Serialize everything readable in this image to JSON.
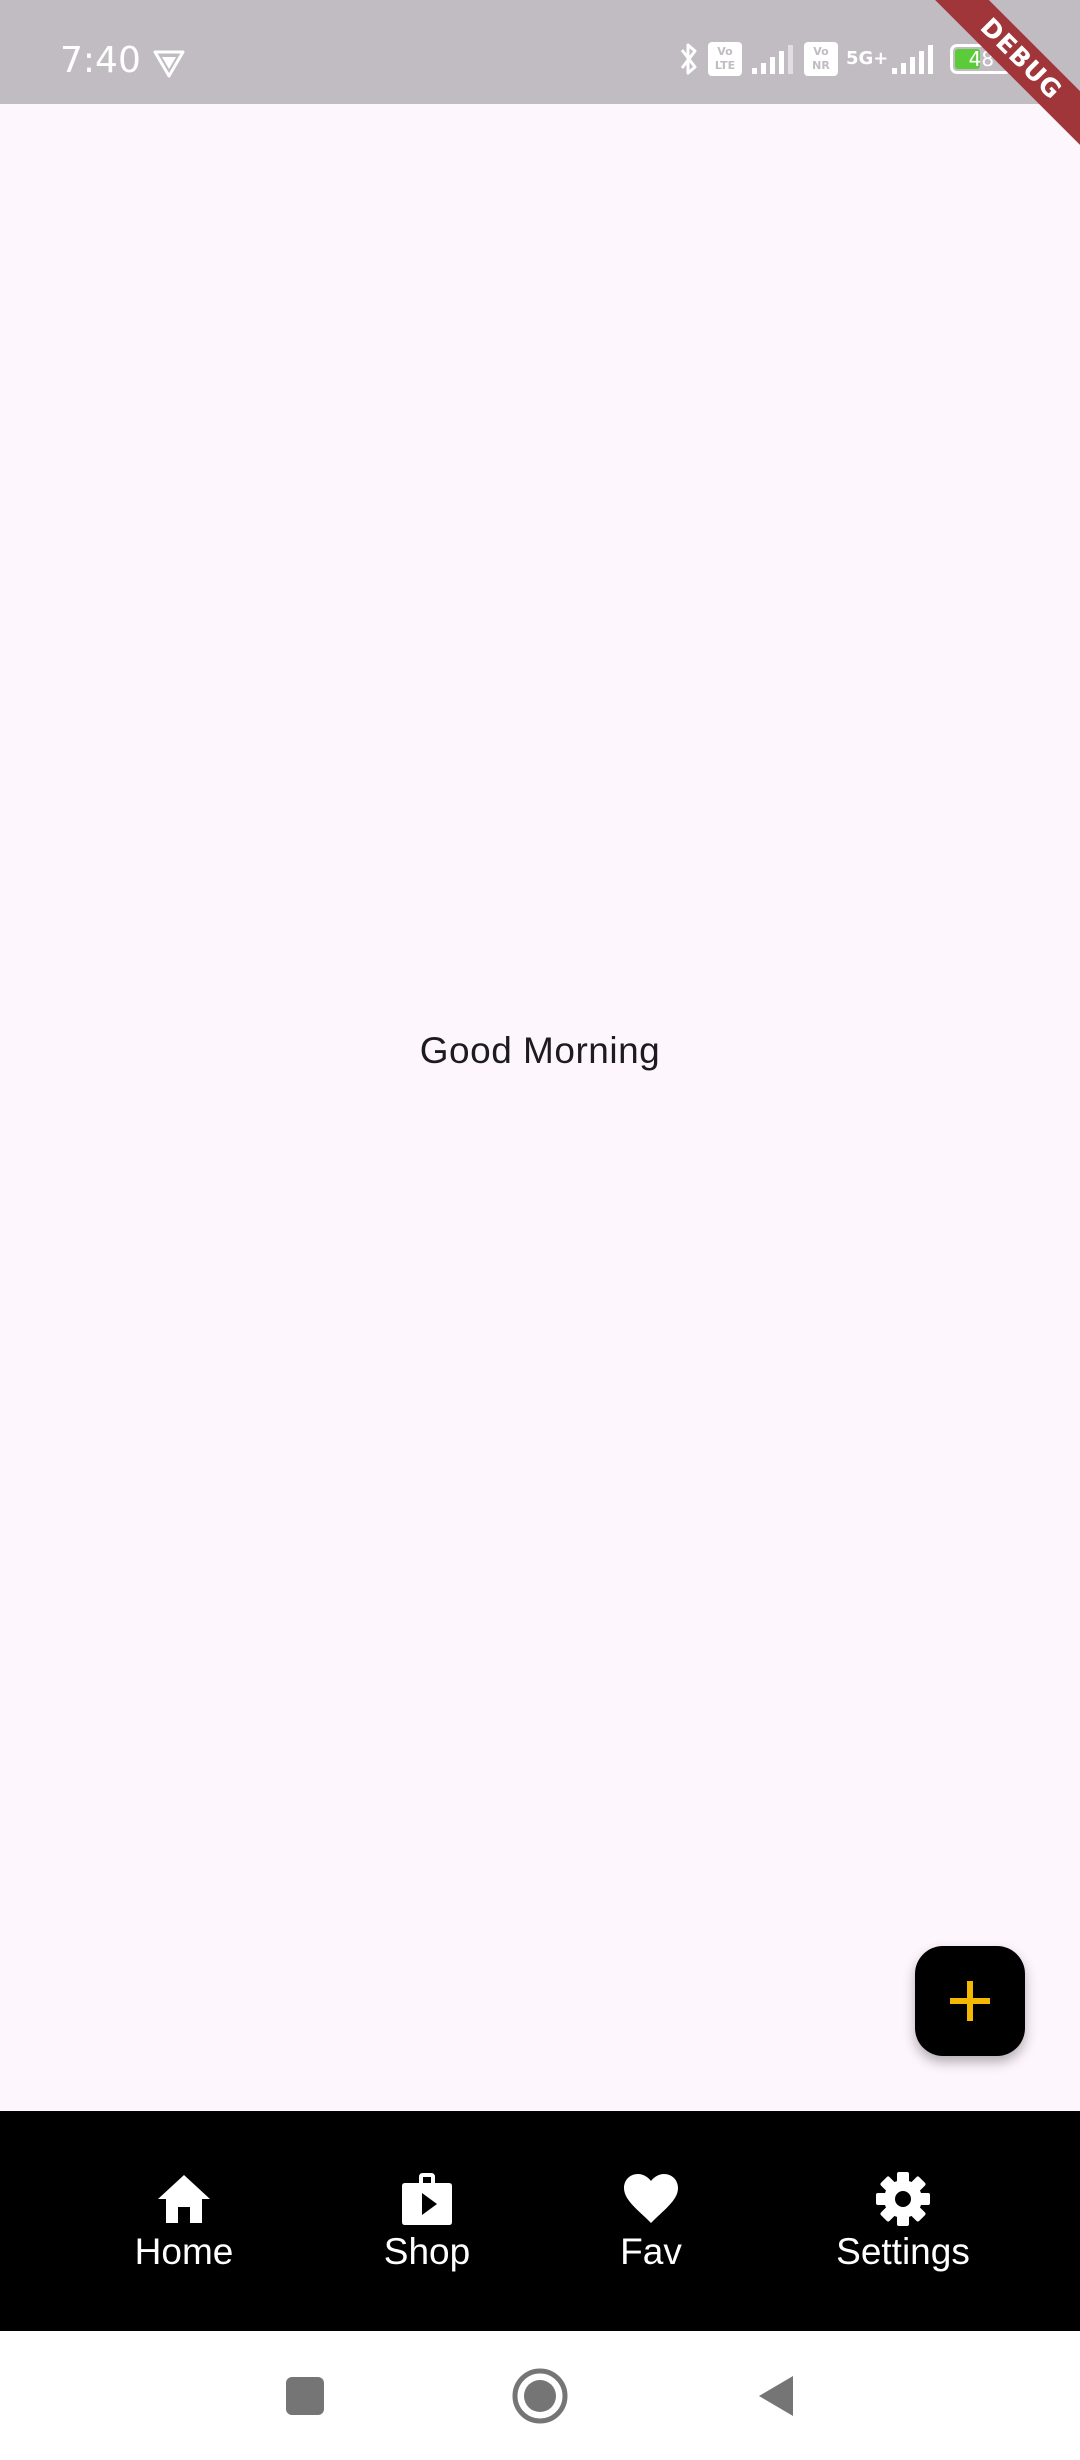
{
  "status_bar": {
    "time": "7:40",
    "battery_level": "48",
    "volte_1_label": "Vo LTE",
    "volte_2_label": "Vo NR",
    "network_label": "5G+",
    "icons": [
      "vpn-shield-icon",
      "bluetooth-icon",
      "volte-icon",
      "signal-icon",
      "vonr-icon",
      "5g-signal-icon",
      "battery-icon",
      "charging-bolt-icon"
    ],
    "background_color": "#c0bcc2"
  },
  "debug_banner": {
    "label": "DEBUG",
    "color": "#a0353a"
  },
  "main": {
    "greeting": "Good Morning",
    "background_color": "#fdf6fd"
  },
  "fab": {
    "icon": "plus-icon",
    "icon_color": "#f5b800"
  },
  "bottom_nav": {
    "background_color": "#000000",
    "items": [
      {
        "label": "Home",
        "icon": "home-icon"
      },
      {
        "label": "Shop",
        "icon": "shopping-bag-icon"
      },
      {
        "label": "Fav",
        "icon": "heart-icon"
      },
      {
        "label": "Settings",
        "icon": "gear-icon"
      }
    ]
  },
  "system_nav": {
    "buttons": [
      "recents-square-icon",
      "home-circle-icon",
      "back-triangle-icon"
    ]
  }
}
